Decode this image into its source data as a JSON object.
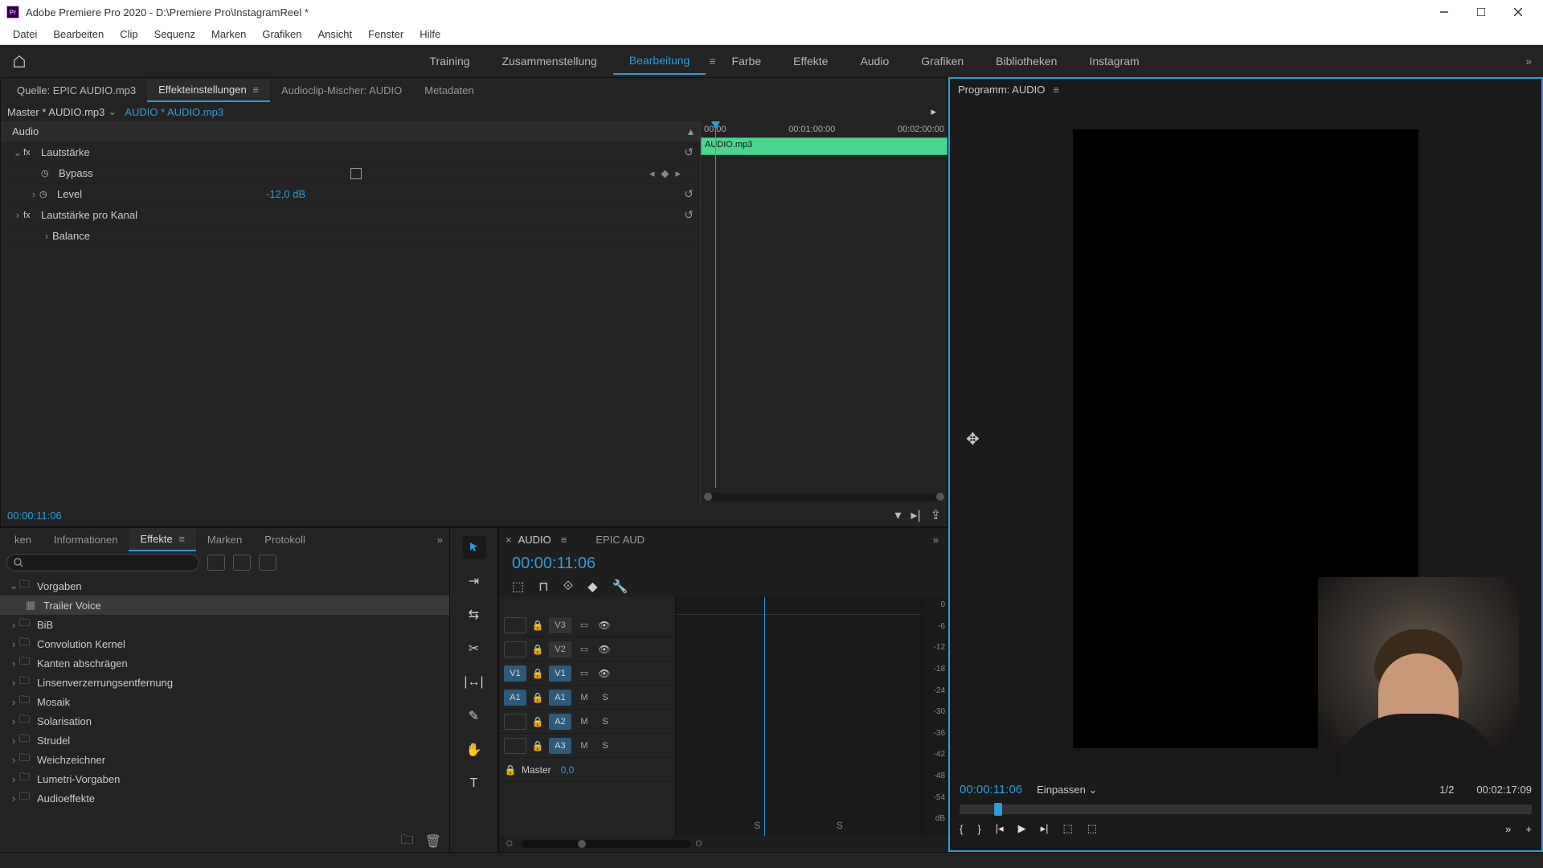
{
  "titlebar": {
    "app": "Adobe Premiere Pro 2020",
    "path": "D:\\Premiere Pro\\InstagramReel *",
    "logo_text": "Pr"
  },
  "menubar": [
    "Datei",
    "Bearbeiten",
    "Clip",
    "Sequenz",
    "Marken",
    "Grafiken",
    "Ansicht",
    "Fenster",
    "Hilfe"
  ],
  "workspaces": {
    "items": [
      "Training",
      "Zusammenstellung",
      "Bearbeitung",
      "Farbe",
      "Effekte",
      "Audio",
      "Grafiken",
      "Bibliotheken",
      "Instagram"
    ],
    "active_index": 2
  },
  "fx_panel": {
    "tabs": {
      "source": "Quelle: EPIC AUDIO.mp3",
      "settings": "Effekteinstellungen",
      "mixer": "Audioclip-Mischer: AUDIO",
      "meta": "Metadaten"
    },
    "master": "Master * AUDIO.mp3",
    "clip": "AUDIO * AUDIO.mp3",
    "audio_hdr": "Audio",
    "volume": "Lautstärke",
    "bypass": "Bypass",
    "level": "Level",
    "level_val": "-12,0 dB",
    "channel": "Lautstärke pro Kanal",
    "balance": "Balance",
    "mini_times": [
      "00:00",
      "00:01:00:00",
      "00:02:00:00"
    ],
    "mini_clip": "AUDIO.mp3",
    "tc": "00:00:11:06"
  },
  "program": {
    "title": "Programm: AUDIO",
    "tc": "00:00:11:06",
    "fit": "Einpassen",
    "zoom": "1/2",
    "duration": "00:02:17:09"
  },
  "fx_browser": {
    "tabs": [
      "ken",
      "Informationen",
      "Effekte",
      "Marken",
      "Protokoll"
    ],
    "active_index": 2,
    "tree": [
      {
        "label": "Vorgaben",
        "open": true,
        "icon": "folder"
      },
      {
        "label": "Trailer Voice",
        "indent": true,
        "icon": "preset",
        "sel": true
      },
      {
        "label": "BiB",
        "icon": "folder"
      },
      {
        "label": "Convolution Kernel",
        "icon": "folder"
      },
      {
        "label": "Kanten abschrägen",
        "icon": "folder"
      },
      {
        "label": "Linsenverzerrungsentfernung",
        "icon": "folder"
      },
      {
        "label": "Mosaik",
        "icon": "folder"
      },
      {
        "label": "Solarisation",
        "icon": "folder"
      },
      {
        "label": "Strudel",
        "icon": "folder"
      },
      {
        "label": "Weichzeichner",
        "icon": "folder"
      },
      {
        "label": "Lumetri-Vorgaben",
        "icon": "folder"
      },
      {
        "label": "Audioeffekte",
        "icon": "folder"
      }
    ]
  },
  "tools": [
    "selection",
    "track-select",
    "ripple",
    "razor",
    "slip",
    "pen",
    "hand",
    "type"
  ],
  "timeline": {
    "seq": "AUDIO",
    "seq2": "EPIC AUD",
    "tc": "00:00:11:06",
    "tracks": {
      "v3": "V3",
      "v2": "V2",
      "v1": "V1",
      "a1": "A1",
      "a2": "A2",
      "a3": "A3",
      "master": "Master",
      "master_val": "0,0"
    },
    "meter_labels": [
      "0",
      "-6",
      "-12",
      "-18",
      "-24",
      "-30",
      "-36",
      "-42",
      "-48",
      "-54",
      "dB"
    ],
    "sio": [
      "S",
      "S"
    ]
  }
}
